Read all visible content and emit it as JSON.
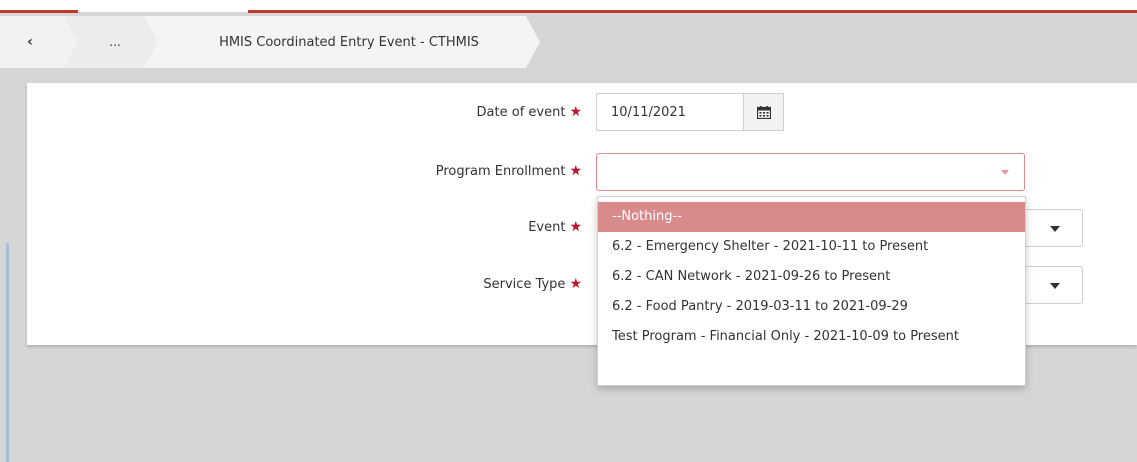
{
  "breadcrumb": {
    "back_icon": "chevron-left-icon",
    "back_glyph": "‹",
    "more_label": "...",
    "current_label": "HMIS Coordinated Entry Event - CTHMIS"
  },
  "form": {
    "date_label": "Date of event",
    "date_value": "10/11/2021",
    "calendar_icon": "calendar-icon",
    "program_label": "Program Enrollment",
    "program_value": "",
    "event_label": "Event",
    "service_type_label": "Service Type",
    "required_marker": "★"
  },
  "dropdown": {
    "options": [
      "--Nothing--",
      "6.2 - Emergency Shelter - 2021-10-11 to Present",
      "6.2 - CAN Network - 2021-09-26 to Present",
      "6.2 - Food Pantry - 2019-03-11 to 2021-09-29",
      "Test Program - Financial Only - 2021-10-09 to Present"
    ],
    "highlighted_index": 0
  },
  "colors": {
    "accent_red": "#c0392b",
    "highlight": "#d98a8a",
    "required": "#c0152f",
    "page_bg": "#d6d6d6"
  }
}
